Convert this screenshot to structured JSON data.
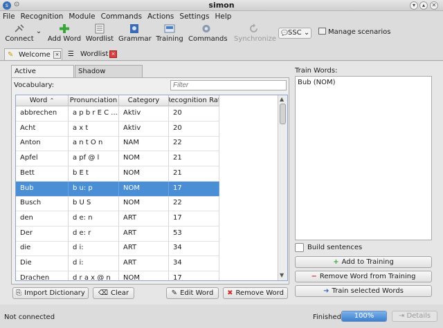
{
  "window": {
    "title": "simon"
  },
  "menu": [
    "File",
    "Recognition",
    "Module",
    "Commands",
    "Actions",
    "Settings",
    "Help"
  ],
  "toolbar": {
    "connect": "Connect",
    "add_word": "Add Word",
    "wordlist": "Wordlist",
    "grammar": "Grammar",
    "training": "Training",
    "commands": "Commands",
    "synchronize": "Synchronize",
    "scenario_selected": "SSC",
    "manage_scenarios": "Manage scenarios"
  },
  "doc_tabs": {
    "welcome": "Welcome",
    "wordlist": "Wordlist"
  },
  "vocab_tabs": {
    "active": "Active Vocabulary",
    "shadow": "Shadow Vocabulary"
  },
  "vocabulary": {
    "label": "Vocabulary:",
    "filter_placeholder": "Filter",
    "columns": [
      "Word",
      "Pronunciation",
      "Category",
      "Recognition Rate"
    ],
    "rows": [
      [
        "abbrechen",
        "a p b r E C ...",
        "Aktiv",
        "20"
      ],
      [
        "Acht",
        "a x t",
        "Aktiv",
        "20"
      ],
      [
        "Anton",
        "a n t O n",
        "NAM",
        "22"
      ],
      [
        "Apfel",
        "a pf @ l",
        "NOM",
        "21"
      ],
      [
        "Bett",
        "b E t",
        "NOM",
        "21"
      ],
      [
        "Bub",
        "b u: p",
        "NOM",
        "17"
      ],
      [
        "Busch",
        "b U S",
        "NOM",
        "22"
      ],
      [
        "den",
        "d e: n",
        "ART",
        "17"
      ],
      [
        "Der",
        "d e: r",
        "ART",
        "53"
      ],
      [
        "die",
        "d i:",
        "ART",
        "34"
      ],
      [
        "Die",
        "d i:",
        "ART",
        "34"
      ],
      [
        "Drachen",
        "d r a x @ n",
        "NOM",
        "17"
      ]
    ],
    "selected_index": 5
  },
  "bottom_buttons": {
    "import": "Import Dictionary",
    "clear": "Clear",
    "edit": "Edit Word",
    "remove": "Remove Word"
  },
  "training": {
    "label": "Train Words:",
    "items": [
      "Bub (NOM)"
    ],
    "build_sentences": "Build sentences",
    "add": "Add to Training",
    "remove": "Remove Word from Training",
    "train_selected": "Train selected Words"
  },
  "status": {
    "connection": "Not connected",
    "finished": "Finished",
    "progress_text": "100%",
    "progress_fraction": 1.0,
    "details": "Details"
  },
  "colors": {
    "selection": "#4a8fd6",
    "progress": "#3c7fcf"
  }
}
